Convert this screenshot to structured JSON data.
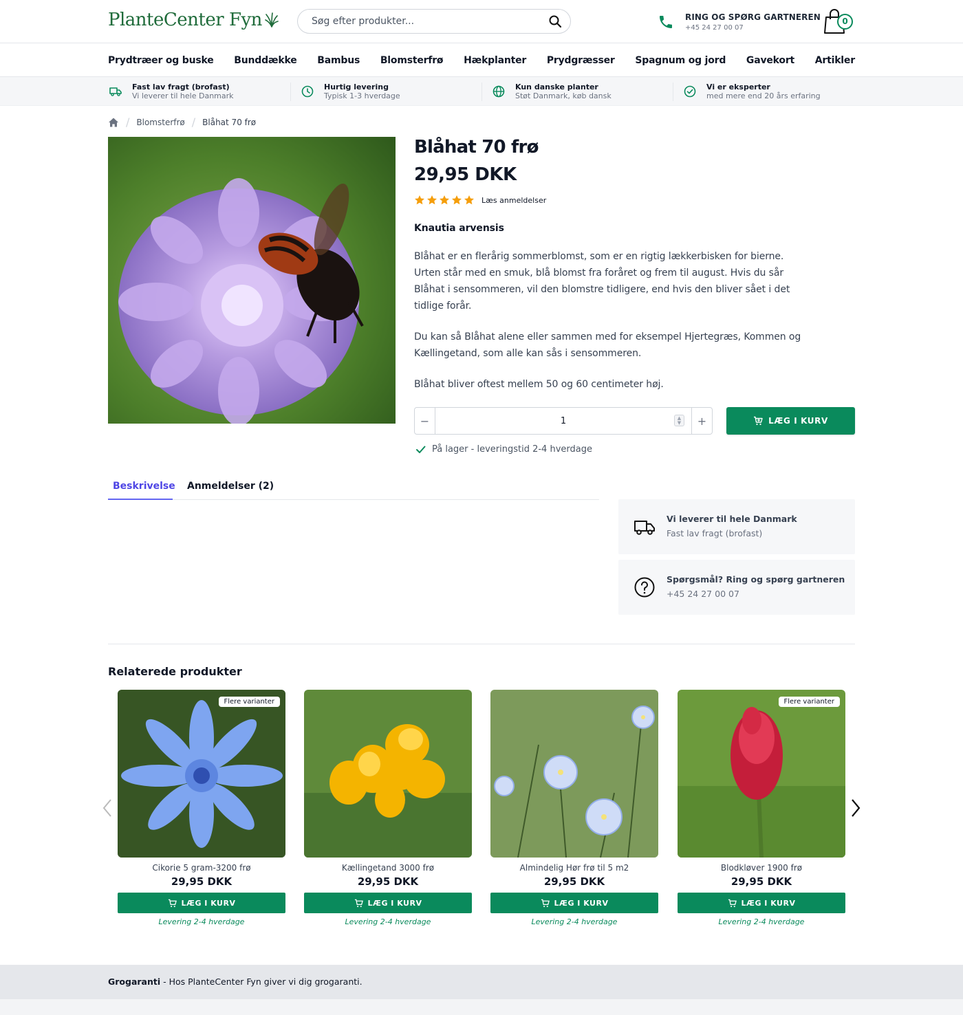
{
  "header": {
    "logo_text": "PlanteCenter Fyn",
    "search_placeholder": "Søg efter produkter...",
    "phone_title": "RING OG SPØRG GARTNEREN",
    "phone_number": "+45 24 27 00 07",
    "cart_count": "0"
  },
  "nav": {
    "items": [
      "Prydtræer og buske",
      "Bunddække",
      "Bambus",
      "Blomsterfrø",
      "Hækplanter",
      "Prydgræsser",
      "Spagnum og jord",
      "Gavekort",
      "Artikler"
    ]
  },
  "usp": [
    {
      "title": "Fast lav fragt (brofast)",
      "sub": "Vi leverer til hele Danmark",
      "icon": "truck-icon"
    },
    {
      "title": "Hurtig levering",
      "sub": "Typisk 1-3 hverdage",
      "icon": "clock-icon"
    },
    {
      "title": "Kun danske planter",
      "sub": "Støt Danmark, køb dansk",
      "icon": "globe-icon"
    },
    {
      "title": "Vi er eksperter",
      "sub": "med mere end 20 års erfaring",
      "icon": "check-circle-icon"
    }
  ],
  "breadcrumb": {
    "category": "Blomsterfrø",
    "current": "Blåhat 70 frø"
  },
  "product": {
    "title": "Blåhat 70 frø",
    "price": "29,95 DKK",
    "rating": 5,
    "reviews_link": "Læs anmeldelser",
    "latin_name": "Knautia arvensis",
    "desc1": "Blåhat er en flerårig sommerblomst, som er en rigtig lækkerbisken for bierne. Urten står med en smuk, blå blomst fra foråret og frem til august. Hvis du sår Blåhat i sensommeren, vil den blomstre tidligere, end hvis den bliver sået i det tidlige forår.",
    "desc2": "Du kan så Blåhat alene eller sammen med for eksempel Hjertegræs, Kommen og Kællingetand, som alle kan sås i sensommeren.",
    "desc3": "Blåhat bliver oftest mellem 50 og 60 centimeter høj.",
    "quantity": "1",
    "add_label": "LÆG I KURV",
    "stock": "På lager - leveringstid 2-4 hverdage"
  },
  "tabs": {
    "description": "Beskrivelse",
    "reviews": "Anmeldelser (2)"
  },
  "info_boxes": {
    "delivery_title": "Vi leverer til hele Danmark",
    "delivery_sub": "Fast lav fragt (brofast)",
    "question_title": "Spørgsmål? Ring og spørg gartneren",
    "question_sub": "+45 24 27 00 07"
  },
  "related": {
    "title": "Relaterede produkter",
    "variants_badge": "Flere varianter",
    "add_label": "LÆG I KURV",
    "delivery": "Levering 2-4 hverdage",
    "items": [
      {
        "name": "Cikorie 5 gram-3200 frø",
        "price": "29,95 DKK",
        "badge": true
      },
      {
        "name": "Kællingetand 3000 frø",
        "price": "29,95 DKK",
        "badge": false
      },
      {
        "name": "Almindelig Hør frø til 5 m2",
        "price": "29,95 DKK",
        "badge": false
      },
      {
        "name": "Blodkløver 1900 frø",
        "price": "29,95 DKK",
        "badge": true
      }
    ]
  },
  "footer": {
    "bold": "Grogaranti",
    "text": " - Hos PlanteCenter Fyn giver vi dig grogaranti."
  },
  "colors": {
    "brand_green": "#0a8a5c",
    "logo_green": "#1f6b3a",
    "tab_accent": "#4f46e5",
    "star": "#f59e0b"
  }
}
